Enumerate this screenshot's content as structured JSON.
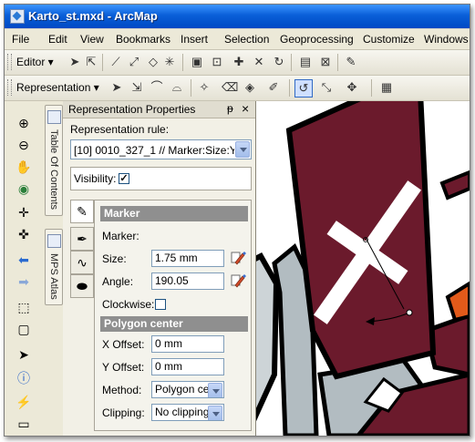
{
  "window": {
    "title": "Karto_st.mxd - ArcMap"
  },
  "menu": [
    "File",
    "Edit",
    "View",
    "Bookmarks",
    "Insert",
    "Selection",
    "Geoprocessing",
    "Customize",
    "Windows"
  ],
  "toolbars": {
    "editor_label": "Editor ▾",
    "representation_label": "Representation ▾"
  },
  "side_tabs": {
    "toc": "Table Of Contents",
    "atlas": "MPS Atlas"
  },
  "panel": {
    "title": "Representation Properties",
    "pin_glyph": "ᵽ",
    "close_glyph": "×",
    "rule_label": "Representation rule:",
    "rule_value": "[10] 0010_327_1  //  Marker:Size:Y",
    "visibility_label": "Visibility:",
    "visibility_checked": true
  },
  "marker": {
    "section_title": "Marker",
    "marker_label": "Marker:",
    "size_label": "Size:",
    "size_value": "1.75 mm",
    "angle_label": "Angle:",
    "angle_value": "190.05",
    "clockwise_label": "Clockwise:",
    "clockwise_checked": false
  },
  "polygon_center": {
    "section_title": "Polygon center",
    "x_offset_label": "X Offset:",
    "x_offset_value": "0 mm",
    "y_offset_label": "Y Offset:",
    "y_offset_value": "0 mm",
    "method_label": "Method:",
    "method_value": "Polygon ce",
    "clipping_label": "Clipping:",
    "clipping_value": "No clipping"
  },
  "colors": {
    "title_bar": "#0a5fd8",
    "map_polygon": "#6b1a2c",
    "map_gray": "#b2bcc1",
    "map_accent": "#e25a1a"
  }
}
